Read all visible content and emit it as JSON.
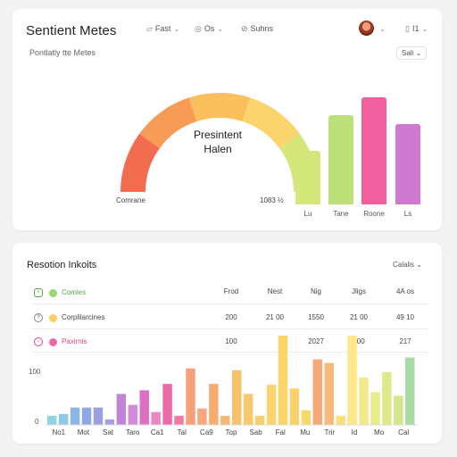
{
  "header": {
    "title": "Sentient Metes",
    "tools": [
      {
        "label": "Fast",
        "icon": "filter-icon"
      },
      {
        "label": "Os",
        "icon": "palette-icon"
      },
      {
        "label": "Suhns",
        "icon": "link-icon"
      }
    ],
    "layout_label": "I1"
  },
  "meters": {
    "subtitle": "Pontlatly tte Metes",
    "range_select": "Sali",
    "gauge_title_1": "Presintent",
    "gauge_title_2": "Halen",
    "gauge_left_label": "Comrane",
    "gauge_right_label": "1083 ½",
    "gauge_colors": [
      "#f26c4f",
      "#f79b57",
      "#fbbf5c",
      "#fcd46e",
      "#d6e67a"
    ],
    "bars": [
      {
        "label": "Lu",
        "value": 0.3,
        "color": "#d4e77a"
      },
      {
        "label": "Tane",
        "value": 0.5,
        "color": "#bde07a"
      },
      {
        "label": "Roone",
        "value": 0.6,
        "color": "#f25f9e"
      },
      {
        "label": "Ls",
        "value": 0.45,
        "color": "#cf78d0"
      }
    ]
  },
  "insights": {
    "title": "Resotion Inkoits",
    "select": "Calalis",
    "columns": [
      "Frod",
      "Nest",
      "Nig",
      "Jligs",
      "4A os"
    ],
    "rows": [
      {
        "name": "Comies",
        "icon": "user-icon",
        "color": "#9ad86e",
        "name_color": "#5aa84a",
        "values": [
          "",
          "",
          "",
          "",
          ""
        ]
      },
      {
        "name": "Corplilarcines",
        "icon": "help-icon",
        "color": "#f5cf6a",
        "name_color": "#555",
        "values": [
          "200",
          "21 00",
          "1550",
          "21 00",
          "49 10"
        ]
      },
      {
        "name": "Paxirnis",
        "icon": "flag-icon",
        "color": "#ee6aa3",
        "name_color": "#e0467f",
        "values": [
          "100",
          "",
          "2027",
          "100",
          "217"
        ]
      }
    ],
    "y_labels": [
      "100",
      "0"
    ],
    "x_labels": [
      "No1",
      "Mot",
      "Sat",
      "Taro",
      "Ca1",
      "Tal",
      "Ca9",
      "Top",
      "Sab",
      "Fal",
      "Mu",
      "Trir",
      "Id",
      "Mo",
      "Cal"
    ],
    "chart_data": {
      "type": "bar",
      "values": [
        {
          "v": 0.1,
          "c": "#8fd3e0"
        },
        {
          "v": 0.12,
          "c": "#8fc9e8"
        },
        {
          "v": 0.19,
          "c": "#89b5e8"
        },
        {
          "v": 0.19,
          "c": "#8fa8e6"
        },
        {
          "v": 0.19,
          "c": "#9aa0e3"
        },
        {
          "v": 0.06,
          "c": "#a7a0e0"
        },
        {
          "v": 0.34,
          "c": "#c084d6"
        },
        {
          "v": 0.22,
          "c": "#d68ad6"
        },
        {
          "v": 0.38,
          "c": "#e06fc8"
        },
        {
          "v": 0.14,
          "c": "#e987c4"
        },
        {
          "v": 0.45,
          "c": "#ec6aa6"
        },
        {
          "v": 0.1,
          "c": "#f07aa0"
        },
        {
          "v": 0.62,
          "c": "#f5a07a"
        },
        {
          "v": 0.18,
          "c": "#f6a87e"
        },
        {
          "v": 0.45,
          "c": "#f8ac70"
        },
        {
          "v": 0.1,
          "c": "#f8b870"
        },
        {
          "v": 0.6,
          "c": "#f9c06c"
        },
        {
          "v": 0.34,
          "c": "#fac86c"
        },
        {
          "v": 0.1,
          "c": "#fbd06c"
        },
        {
          "v": 0.44,
          "c": "#fcd46e"
        },
        {
          "v": 0.98,
          "c": "#fbd56a"
        },
        {
          "v": 0.4,
          "c": "#fbd26a"
        },
        {
          "v": 0.16,
          "c": "#f9d86c"
        },
        {
          "v": 0.72,
          "c": "#f6a97a"
        },
        {
          "v": 0.68,
          "c": "#f7b97a"
        },
        {
          "v": 0.1,
          "c": "#f9e07a"
        },
        {
          "v": 0.98,
          "c": "#fce58a"
        },
        {
          "v": 0.52,
          "c": "#f2ea8a"
        },
        {
          "v": 0.36,
          "c": "#e7ec8c"
        },
        {
          "v": 0.58,
          "c": "#dde98a"
        },
        {
          "v": 0.32,
          "c": "#d2e68c"
        },
        {
          "v": 0.74,
          "c": "#a4dca2"
        }
      ]
    }
  }
}
